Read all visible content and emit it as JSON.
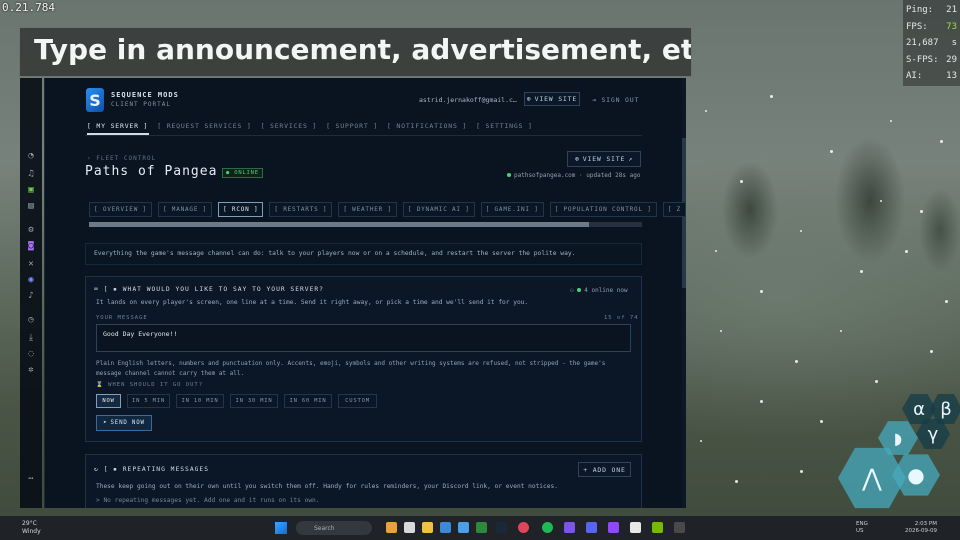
{
  "overlay": {
    "coordinates": "0.21.784",
    "caption": "Type in announcement, advertisement, etc",
    "stats": [
      {
        "label": "Ping:",
        "value": "21"
      },
      {
        "label": "FPS:",
        "value": "73"
      },
      {
        "label": "21,687",
        "value": "s"
      },
      {
        "label": "S-FPS:",
        "value": "29"
      },
      {
        "label": "AI:",
        "value": "13"
      }
    ]
  },
  "app": {
    "brand_name": "SEQUENCE MODS",
    "brand_sub": "CLIENT PORTAL",
    "user_email": "astrid.jernakoff@gmail.c…",
    "view_site_label": "VIEW SITE",
    "sign_out_label": "SIGN OUT",
    "nav": [
      "[ MY SERVER ]",
      "[ REQUEST SERVICES ]",
      "[ SERVICES ]",
      "[ SUPPORT ]",
      "[ NOTIFICATIONS ]",
      "[ SETTINGS ]"
    ],
    "breadcrumb": "› FLEET CONTROL",
    "server_title": "Paths of Pangea",
    "status_badge": "● ONLINE",
    "server_view_site": "VIEW SITE",
    "server_url": "pathsofpangea.com · updated 28s ago",
    "tabs": [
      "[ OVERVIEW ]",
      "[ MANAGE ]",
      "[ RCON ]",
      "[ RESTARTS ]",
      "[ WEATHER ]",
      "[ DYNAMIC AI ]",
      "[ GAME.INI ]",
      "[ POPULATION CONTROL ]",
      "[ Z"
    ],
    "intro": "Everything the game's message channel can do: talk to your players now or on a schedule, and restart the server the polite way.",
    "say_panel": {
      "title": "WHAT WOULD YOU LIKE TO SAY TO YOUR SERVER?",
      "online": "4 online now",
      "desc": "It lands on every player's screen, one line at a time. Send it right away, or pick a time and we'll send it for you.",
      "message_label": "YOUR MESSAGE",
      "char_count": "15 of 74",
      "message_value": "Good Day Everyone!!",
      "note": "Plain English letters, numbers and punctuation only. Accents, emoji, symbols and other writing systems are refused, not stripped - the game's message channel cannot carry them at all.",
      "when_label": "WHEN SHOULD IT GO OUT?",
      "times": [
        "NOW",
        "IN 5 MIN",
        "IN 10 MIN",
        "IN 30 MIN",
        "IN 60 MIN",
        "CUSTOM"
      ],
      "send_label": "SEND NOW"
    },
    "repeat_panel": {
      "title": "REPEATING MESSAGES",
      "add_label": "+ ADD ONE",
      "desc": "These keep going out on their own until you switch them off. Handy for rules reminders, your Discord link, or event notices.",
      "empty": "> No repeating messages yet. Add one and it runs on its own."
    }
  },
  "hex_widget": [
    "α",
    "β",
    "γ"
  ],
  "taskbar": {
    "weather_temp": "29°C",
    "weather_desc": "Windy",
    "search_placeholder": "Search",
    "lang_top": "ENG",
    "lang_bottom": "US",
    "clock_time": "2:03 PM",
    "clock_date": "2026-09-09"
  },
  "colors": {
    "accent": "#2a8ff0",
    "online": "#49d07a",
    "panel_bg": "#0b1726",
    "app_bg": "#0a1320"
  }
}
